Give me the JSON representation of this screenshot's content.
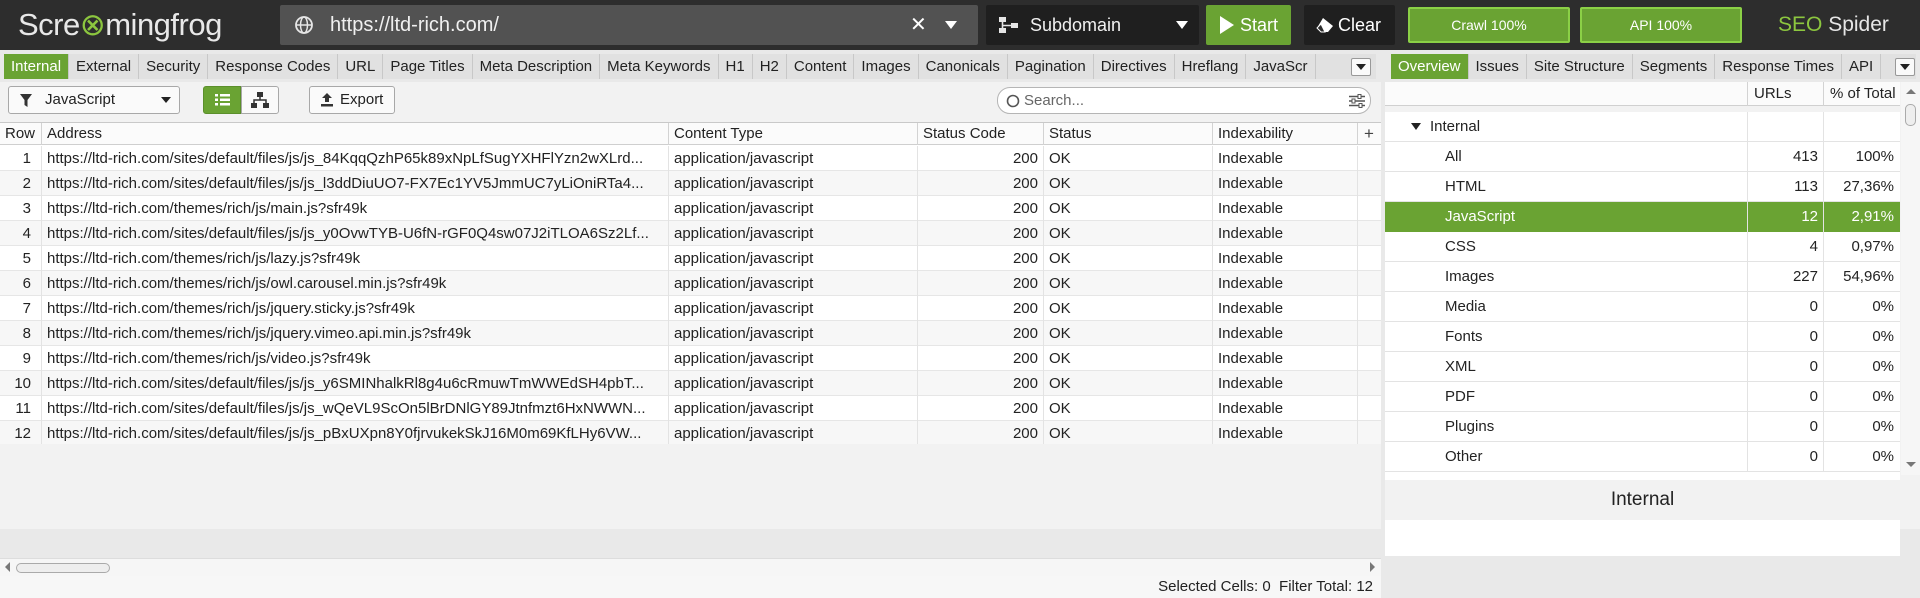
{
  "app": {
    "logo_left": "Scre",
    "logo_frog": "⊗",
    "logo_right": "mingfrog",
    "seo": "SEO",
    "spider": "Spider"
  },
  "toolbar": {
    "url": "https://ltd-rich.com/",
    "url_clear": "✕",
    "mode": "Subdomain",
    "start_label": "Start",
    "clear_label": "Clear",
    "crawl_status": "Crawl 100%",
    "api_status": "API 100%"
  },
  "left_tabs": [
    "Internal",
    "External",
    "Security",
    "Response Codes",
    "URL",
    "Page Titles",
    "Meta Description",
    "Meta Keywords",
    "H1",
    "H2",
    "Content",
    "Images",
    "Canonicals",
    "Pagination",
    "Directives",
    "Hreflang",
    "JavaScr"
  ],
  "left_active_tab": "Internal",
  "right_tabs": [
    "Overview",
    "Issues",
    "Site Structure",
    "Segments",
    "Response Times",
    "API"
  ],
  "right_active_tab": "Overview",
  "filter": {
    "value": "JavaScript",
    "export_label": "Export",
    "search_placeholder": "Search..."
  },
  "grid": {
    "columns": [
      "Row",
      "Address",
      "Content Type",
      "Status Code",
      "Status",
      "Indexability"
    ],
    "add_column": "+",
    "rows": [
      [
        "1",
        "https://ltd-rich.com/sites/default/files/js/js_84KqqQzhP65k89xNpLfSugYXHFlYzn2wXLrd...",
        "application/javascript",
        "200",
        "OK",
        "Indexable"
      ],
      [
        "2",
        "https://ltd-rich.com/sites/default/files/js/js_l3ddDiuUO7-FX7Ec1YV5JmmUC7yLiOniRTa4...",
        "application/javascript",
        "200",
        "OK",
        "Indexable"
      ],
      [
        "3",
        "https://ltd-rich.com/themes/rich/js/main.js?sfr49k",
        "application/javascript",
        "200",
        "OK",
        "Indexable"
      ],
      [
        "4",
        "https://ltd-rich.com/sites/default/files/js/js_y0OvwTYB-U6fN-rGF0Q4sw07J2iTLOA6Sz2Lf...",
        "application/javascript",
        "200",
        "OK",
        "Indexable"
      ],
      [
        "5",
        "https://ltd-rich.com/themes/rich/js/lazy.js?sfr49k",
        "application/javascript",
        "200",
        "OK",
        "Indexable"
      ],
      [
        "6",
        "https://ltd-rich.com/themes/rich/js/owl.carousel.min.js?sfr49k",
        "application/javascript",
        "200",
        "OK",
        "Indexable"
      ],
      [
        "7",
        "https://ltd-rich.com/themes/rich/js/jquery.sticky.js?sfr49k",
        "application/javascript",
        "200",
        "OK",
        "Indexable"
      ],
      [
        "8",
        "https://ltd-rich.com/themes/rich/js/jquery.vimeo.api.min.js?sfr49k",
        "application/javascript",
        "200",
        "OK",
        "Indexable"
      ],
      [
        "9",
        "https://ltd-rich.com/themes/rich/js/video.js?sfr49k",
        "application/javascript",
        "200",
        "OK",
        "Indexable"
      ],
      [
        "10",
        "https://ltd-rich.com/sites/default/files/js/js_y6SMINhalkRl8g4u6cRmuwTmWWEdSH4pbT...",
        "application/javascript",
        "200",
        "OK",
        "Indexable"
      ],
      [
        "11",
        "https://ltd-rich.com/sites/default/files/js/js_wQeVL9ScOn5lBrDNlGY89Jtnfmzt6HxNWWN...",
        "application/javascript",
        "200",
        "OK",
        "Indexable"
      ],
      [
        "12",
        "https://ltd-rich.com/sites/default/files/js/js_pBxUXpn8Y0fjrvukekSkJ16M0m69KfLHy6VW...",
        "application/javascript",
        "200",
        "OK",
        "Indexable"
      ]
    ]
  },
  "status": {
    "selected_label": "Selected Cells:",
    "selected_value": "0",
    "filter_label": "Filter Total:",
    "filter_value": "12"
  },
  "overview": {
    "columns": [
      "URLs",
      "% of Total"
    ],
    "group": "Internal",
    "rows": [
      {
        "label": "All",
        "urls": "413",
        "pct": "100%"
      },
      {
        "label": "HTML",
        "urls": "113",
        "pct": "27,36%"
      },
      {
        "label": "JavaScript",
        "urls": "12",
        "pct": "2,91%"
      },
      {
        "label": "CSS",
        "urls": "4",
        "pct": "0,97%"
      },
      {
        "label": "Images",
        "urls": "227",
        "pct": "54,96%"
      },
      {
        "label": "Media",
        "urls": "0",
        "pct": "0%"
      },
      {
        "label": "Fonts",
        "urls": "0",
        "pct": "0%"
      },
      {
        "label": "XML",
        "urls": "0",
        "pct": "0%"
      },
      {
        "label": "PDF",
        "urls": "0",
        "pct": "0%"
      },
      {
        "label": "Plugins",
        "urls": "0",
        "pct": "0%"
      },
      {
        "label": "Other",
        "urls": "0",
        "pct": "0%"
      }
    ],
    "selected": "JavaScript",
    "chart_title": "Internal"
  },
  "colors": {
    "accent": "#6aa333",
    "dark_bar": "#2d2d2d"
  }
}
